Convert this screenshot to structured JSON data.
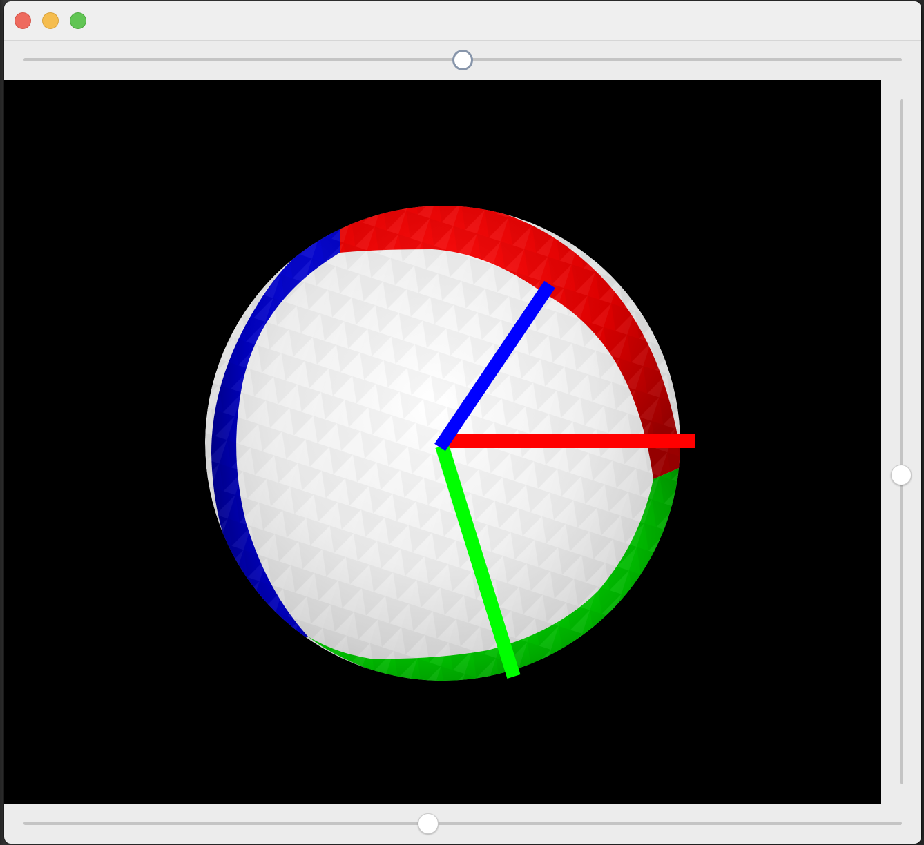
{
  "window": {
    "title": "",
    "controls": {
      "close": "close-button",
      "minimize": "minimize-button",
      "zoom": "zoom-button"
    }
  },
  "sliders": {
    "top": {
      "orientation": "horizontal",
      "value": 0.5,
      "focused": true
    },
    "right": {
      "orientation": "vertical",
      "value": 0.55
    },
    "bottom": {
      "orientation": "horizontal",
      "value": 0.46
    }
  },
  "scene": {
    "background": "#000000",
    "sphere": {
      "base_color": "#ffffff",
      "cap_colors": {
        "x": "#e00000",
        "y": "#00c800",
        "z": "#0000c8"
      }
    },
    "axes": [
      {
        "name": "x",
        "color": "#ff0000"
      },
      {
        "name": "y",
        "color": "#00ff00"
      },
      {
        "name": "z",
        "color": "#0000ff"
      }
    ]
  }
}
